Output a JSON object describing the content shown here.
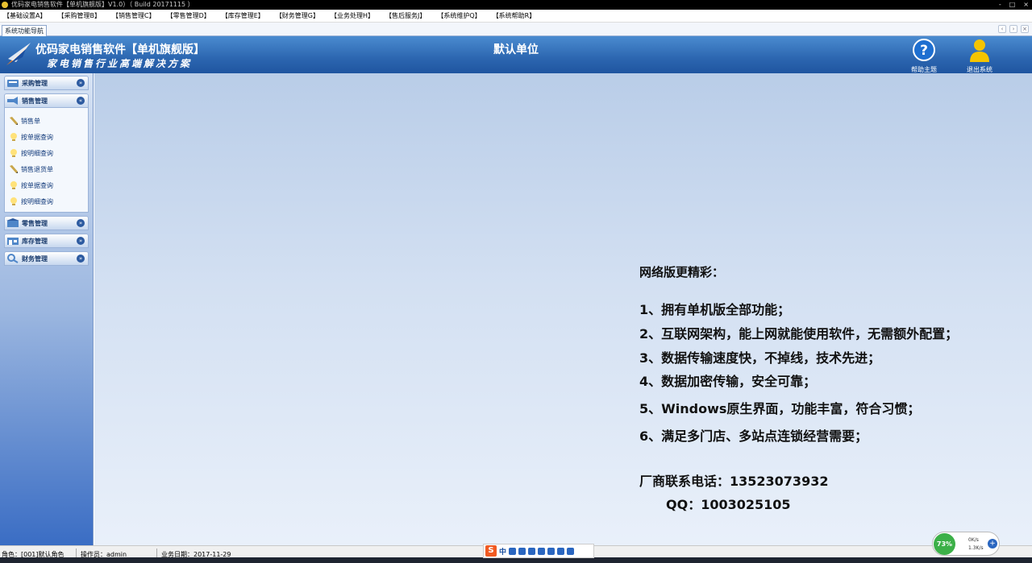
{
  "window": {
    "title": "优码家电销售软件【单机旗舰版】V1.0）（ Build 20171115 ）",
    "controls": [
      "-",
      "□",
      "×"
    ]
  },
  "menubar": {
    "items": [
      "【基础设置A】",
      "【采购管理B】",
      "【销售管理C】",
      "【零售管理D】",
      "【库存管理E】",
      "【财务管理G】",
      "【业务处理H】",
      "【售后服务J】",
      "【系统维护Q】",
      "【系统帮助R】"
    ]
  },
  "tab": {
    "label": "系统功能导航"
  },
  "header": {
    "brand": "优码家电销售软件【单机旗舰版】",
    "slogan": "家电销售行业高端解决方案",
    "company": "默认单位",
    "help_label": "帮助主题",
    "exit_label": "退出系统"
  },
  "sidebar": {
    "panels": [
      {
        "label": "采购管理",
        "expanded": false
      },
      {
        "label": "销售管理",
        "expanded": true
      },
      {
        "label": "零售管理",
        "expanded": false
      },
      {
        "label": "库存管理",
        "expanded": false
      },
      {
        "label": "财务管理",
        "expanded": false
      }
    ],
    "sales_items": [
      {
        "label": "销售单",
        "icon": "pen-icon"
      },
      {
        "label": "按单据查询",
        "icon": "bulb-icon"
      },
      {
        "label": "按明细查询",
        "icon": "bulb-icon"
      },
      {
        "label": "销售退货单",
        "icon": "pen-icon"
      },
      {
        "label": "按单据查询",
        "icon": "bulb-icon"
      },
      {
        "label": "按明细查询",
        "icon": "bulb-icon"
      }
    ]
  },
  "promo": {
    "title": "网络版更精彩：",
    "lines": [
      "1、拥有单机版全部功能；",
      "2、互联网架构，能上网就能使用软件，无需额外配置；",
      "3、数据传输速度快，不掉线，技术先进；",
      "4、数据加密传输，安全可靠；",
      "5、Windows原生界面，功能丰富，符合习惯；",
      "6、满足多门店、多站点连锁经营需要；"
    ],
    "contact_phone": "厂商联系电话：13523073932",
    "contact_qq": "QQ：1003025105"
  },
  "statusbar": {
    "role": "角色：[001]默认角色",
    "operator": "操作员：admin",
    "date": "业务日期：2017-11-29"
  },
  "ime": {
    "mode": "中"
  },
  "netwidget": {
    "percent": "73%",
    "up": "0K/s",
    "down": "1.3K/s"
  },
  "colors": {
    "header": "#2c66b0",
    "sidebar_bottom": "#3a6dc4",
    "main_bg": "#d3e0f2"
  }
}
